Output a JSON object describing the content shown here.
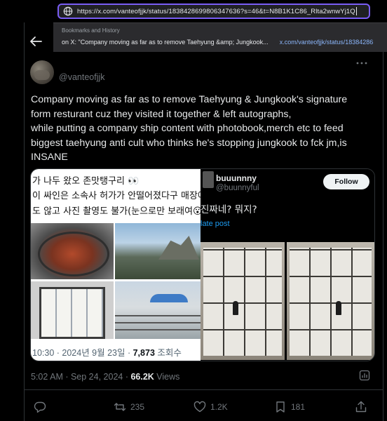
{
  "browser": {
    "url": "https://x.com/vanteofjjk/status/1838428699806347636?s=46&t=N8B1K1C86_Rlta2wnwYj1Q",
    "dropdown": {
      "header": "Bookmarks and History",
      "suggestion_text": "on X: \"Company moving as far as to remove Taehyung &amp; Jungkook...",
      "suggestion_url": "x.com/vanteofjjk/status/18384286"
    }
  },
  "tweet": {
    "handle": "@vanteofjjk",
    "text_lines": [
      "Company moving as far as to remove Taehyung & Jungkook's signature",
      "form resturant cuz they visited it together & left autographs,",
      "while putting a company ship content with photobook,merch etc to feed",
      "biggest taehyung anti cult who thinks he's stopping jungkook to fck jm,is",
      "INSANE"
    ],
    "timestamp": "5:02 AM · Sep 24, 2024 · ",
    "views_count": "66.2K",
    "views_label": " Views"
  },
  "media_left": {
    "lines": [
      "가 나두 왔오 존맛탱구리 👀",
      "이 싸인은 소속사 허가가 안떨어졌다구 매장에",
      "도 않고 사진 촬영도 불가(눈으로만 보래여😮"
    ],
    "meta_prefix": "10:30 · 2024년 9월 23일 · ",
    "meta_views": "7,873",
    "meta_suffix": " 조회수"
  },
  "media_right": {
    "name": "buuunnny",
    "handle": "@buunnyful",
    "follow_label": "Follow",
    "text": "진짜네? 뭐지?",
    "translate_label": "late post"
  },
  "actions": {
    "reply_count": "",
    "retweet_count": "235",
    "like_count": "1.2K",
    "bookmark_count": "181"
  },
  "colors": {
    "accent_blue": "#1d9bf0",
    "url_focus": "#7a5df5",
    "background": "#000000",
    "text_primary": "#e7e9ea",
    "text_secondary": "#71767b"
  }
}
